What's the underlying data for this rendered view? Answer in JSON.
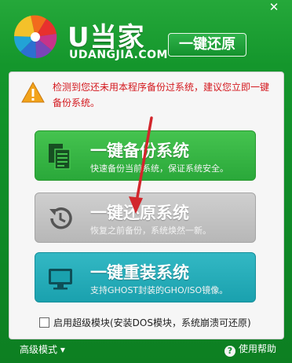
{
  "window": {
    "close_glyph": "✕"
  },
  "brand": {
    "title": "U当家",
    "subtitle": "UDANGJIA.COM",
    "badge": "一键还原"
  },
  "notice": {
    "text": "检测到您还未用本程序备份过系统，建议您立即一键备份系统。"
  },
  "actions": [
    {
      "title": "一键备份系统",
      "desc": "快速备份当前系统，保证系统安全。",
      "icon": "document-copy-icon"
    },
    {
      "title": "一键还原系统",
      "desc": "恢复之前备份，系统焕然一新。",
      "icon": "restore-history-icon"
    },
    {
      "title": "一键重装系统",
      "desc": "支持GHOST封装的GHO/ISO镜像。",
      "icon": "monitor-icon"
    }
  ],
  "option": {
    "label": "启用超级模块(安装DOS模块，系统崩溃可还原)",
    "checked": false
  },
  "footer": {
    "advanced_label": "高级模式",
    "help_label": "使用帮助"
  },
  "colors": {
    "brand_green": "#14962c",
    "warning_red": "#d4181e",
    "backup_green": "#2aa83a",
    "restore_gray": "#b7b7b7",
    "reinstall_teal": "#1aa1ae",
    "annotation_arrow": "#d2262c"
  }
}
